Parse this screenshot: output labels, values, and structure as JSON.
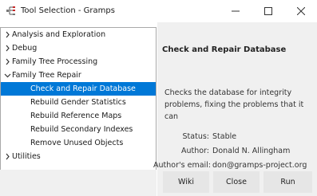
{
  "window": {
    "title": "Tool Selection - Gramps",
    "controls": {
      "minimize": "—",
      "maximize": "☐",
      "close": "✕"
    }
  },
  "tree": {
    "items": [
      {
        "label": "Analysis and Exploration",
        "expanded": false,
        "level": 0
      },
      {
        "label": "Debug",
        "expanded": false,
        "level": 0
      },
      {
        "label": "Family Tree Processing",
        "expanded": false,
        "level": 0
      },
      {
        "label": "Family Tree Repair",
        "expanded": true,
        "level": 0
      },
      {
        "label": "Check and Repair Database",
        "level": 1,
        "selected": true
      },
      {
        "label": "Rebuild Gender Statistics",
        "level": 1
      },
      {
        "label": "Rebuild Reference Maps",
        "level": 1
      },
      {
        "label": "Rebuild Secondary Indexes",
        "level": 1
      },
      {
        "label": "Remove Unused Objects",
        "level": 1
      },
      {
        "label": "Utilities",
        "expanded": false,
        "level": 0
      }
    ]
  },
  "details": {
    "heading": "Check and Repair Database",
    "description": "Checks the database for integrity problems, fixing the problems that it can",
    "status_label": "Status:",
    "status_value": "Stable",
    "author_label": "Author:",
    "author_value": "Donald N. Allingham",
    "email_label": "Author's email:",
    "email_value": "don@gramps-project.org"
  },
  "buttons": {
    "wiki": "Wiki",
    "close": "Close",
    "run": "Run"
  },
  "colors": {
    "selection": "#0078d7",
    "panel_bg": "#f0f0f0",
    "border": "#a9a9a9"
  },
  "icons": {
    "app": "gramps-tree-icon",
    "collapsed": "chevron-right-icon",
    "expanded": "chevron-down-icon"
  }
}
